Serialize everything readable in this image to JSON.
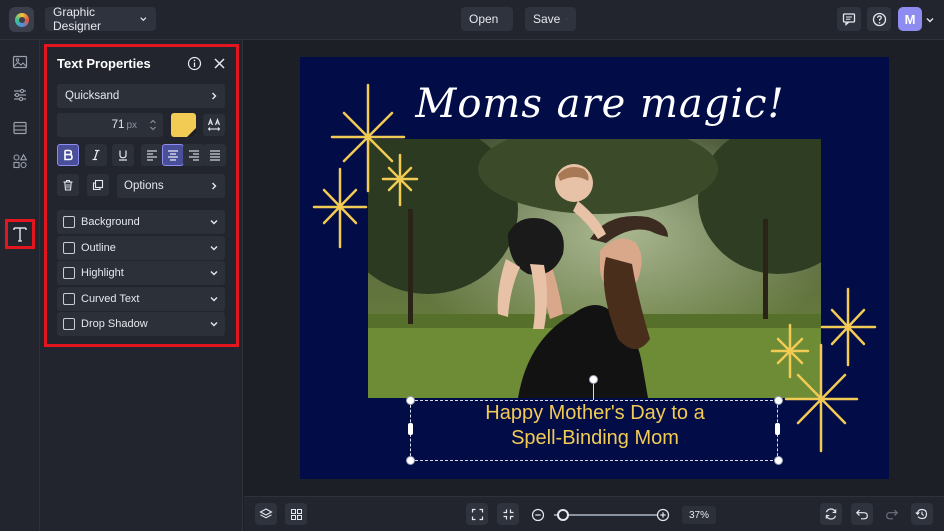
{
  "topbar": {
    "app_mode": "Graphic Designer",
    "open_label": "Open",
    "save_label": "Save",
    "avatar_initial": "M"
  },
  "rail": {
    "items": [
      "image-icon",
      "adjustments-icon",
      "layout-icon",
      "shapes-icon",
      "text-icon"
    ],
    "selected": "text-icon"
  },
  "text_panel": {
    "title": "Text Properties",
    "font_name": "Quicksand",
    "font_size": "71",
    "font_size_unit": "px",
    "text_color": "#f2cb55",
    "options_label": "Options",
    "sections": [
      "Background",
      "Outline",
      "Highlight",
      "Curved Text",
      "Drop Shadow"
    ]
  },
  "design": {
    "headline": "Moms are magic!",
    "subtitle_line1": "Happy Mother's Day to a",
    "subtitle_line2": "Spell-Binding Mom",
    "background_color": "#020c46",
    "accent_color": "#f2cb55"
  },
  "bottombar": {
    "zoom_percent": "37",
    "zoom_unit": "%"
  }
}
